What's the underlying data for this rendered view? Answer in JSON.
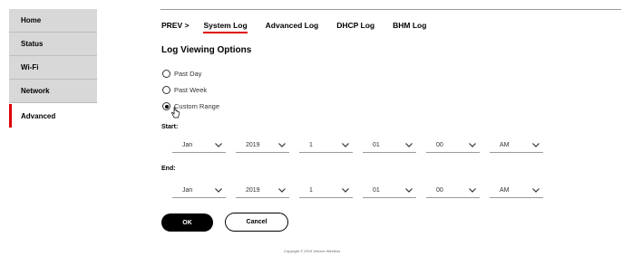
{
  "sidebar": {
    "items": [
      {
        "label": "Home"
      },
      {
        "label": "Status"
      },
      {
        "label": "Wi-Fi"
      },
      {
        "label": "Network"
      },
      {
        "label": "Advanced"
      }
    ]
  },
  "tabs": {
    "prev": "PREV >",
    "items": [
      {
        "label": "System Log"
      },
      {
        "label": "Advanced Log"
      },
      {
        "label": "DHCP Log"
      },
      {
        "label": "BHM Log"
      }
    ]
  },
  "main": {
    "title": "Log Viewing Options",
    "options": [
      {
        "label": "Past Day",
        "selected": false
      },
      {
        "label": "Past Week",
        "selected": false
      },
      {
        "label": "Custom Range",
        "selected": true
      }
    ],
    "start_label": "Start:",
    "end_label": "End:",
    "start": {
      "month": "Jan",
      "year": "2019",
      "day": "1",
      "hour": "01",
      "minute": "00",
      "ampm": "AM"
    },
    "end": {
      "month": "Jan",
      "year": "2019",
      "day": "1",
      "hour": "01",
      "minute": "00",
      "ampm": "AM"
    },
    "ok_label": "OK",
    "cancel_label": "Cancel"
  },
  "footer": {
    "text": "Copyright © 2019 Verizon Wireless"
  },
  "colors": {
    "accent": "#e00000",
    "sidebar_bg": "#d8d8d8"
  }
}
